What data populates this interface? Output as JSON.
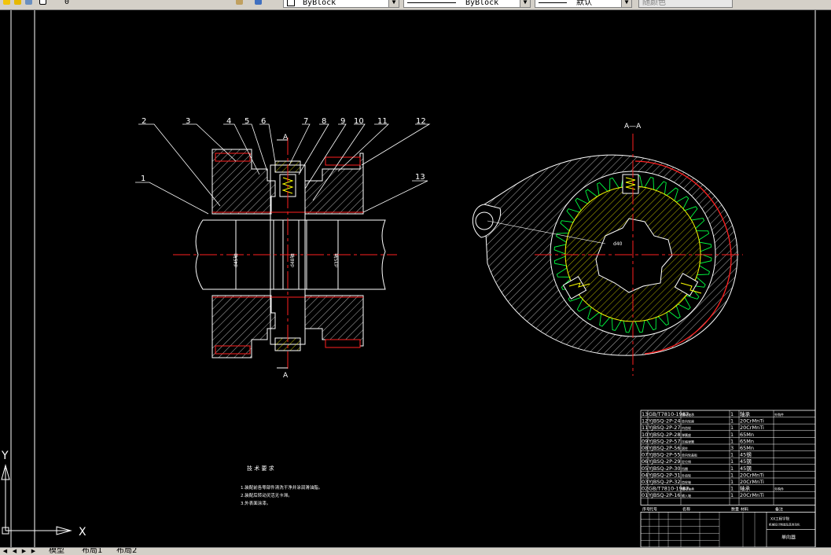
{
  "toolbar": {
    "layer_value": "0",
    "color_value": "ByBlock",
    "linetype_value": "ByBlock",
    "lineweight_value": "默认",
    "plotstyle_value": "随颜色"
  },
  "drawing": {
    "section_label": "A—A",
    "cut_label_top": "A",
    "cut_label_bottom": "A",
    "callouts": [
      "1",
      "2",
      "3",
      "4",
      "5",
      "6",
      "7",
      "8",
      "9",
      "10",
      "11",
      "12",
      "13"
    ],
    "dims": [
      "d45轴",
      "d48轴",
      "d35轴",
      "d40"
    ],
    "tech_title": "技 术 要 求",
    "tech_notes": [
      "1.装配前各零部件清洗干净并涂润滑油脂。",
      "2.装配后转动灵活无卡滞。",
      "3.外表面涂漆。"
    ],
    "ucs_y": "Y",
    "ucs_x": "X"
  },
  "bom": {
    "rows": [
      {
        "no": "13",
        "code": "GB/T7810-1987",
        "name": "滚动轴承",
        "qty": "1",
        "mat": "轴承",
        "note": "外购件"
      },
      {
        "no": "12",
        "code": "YJBSQ-2P-24",
        "name": "单向轮座",
        "qty": "1",
        "mat": "20CrMnTi",
        "note": ""
      },
      {
        "no": "11",
        "code": "YJBSQ-2P-27",
        "name": "内齿轮",
        "qty": "1",
        "mat": "20CrMnTi",
        "note": ""
      },
      {
        "no": "10",
        "code": "YJBSQ-2P-28",
        "name": "弹簧座",
        "qty": "1",
        "mat": "65Mn",
        "note": ""
      },
      {
        "no": "09",
        "code": "YJBSQ-2P-57",
        "name": "压缩弹簧",
        "qty": "1",
        "mat": "65Mn",
        "note": ""
      },
      {
        "no": "08",
        "code": "YJBSQ-2P-56",
        "name": "滚柱",
        "qty": "3",
        "mat": "65Mn",
        "note": ""
      },
      {
        "no": "07",
        "code": "YJBSQ-2P-55",
        "name": "单向轮盖板",
        "qty": "1",
        "mat": "45钢",
        "note": ""
      },
      {
        "no": "06",
        "code": "YJBSQ-2P-29",
        "name": "定位销",
        "qty": "1",
        "mat": "45钢",
        "note": ""
      },
      {
        "no": "05",
        "code": "YJBSQ-2P-30",
        "name": "挡圈",
        "qty": "1",
        "mat": "45钢",
        "note": ""
      },
      {
        "no": "04",
        "code": "YJBSQ-2P-31",
        "name": "外齿轮",
        "qty": "1",
        "mat": "20CrMnTi",
        "note": ""
      },
      {
        "no": "03",
        "code": "YJBSQ-2P-32",
        "name": "齿轮轴",
        "qty": "1",
        "mat": "20CrMnTi",
        "note": ""
      },
      {
        "no": "02",
        "code": "GB/T7810-1987",
        "name": "滚动轴承",
        "qty": "1",
        "mat": "轴承",
        "note": "外购件"
      },
      {
        "no": "01",
        "code": "YJBSQ-2P-16",
        "name": "输入轴",
        "qty": "1",
        "mat": "20CrMnTi",
        "note": ""
      }
    ],
    "header": {
      "no": "序号",
      "code": "代号",
      "name": "名称",
      "qty": "数量",
      "mat": "材料",
      "note": "备注"
    },
    "title_block": {
      "drawing_title": "单向器",
      "unit": "XX工程学院",
      "sub": "机械设计制造及其自动化"
    }
  },
  "tabs": {
    "model": "模型",
    "layout1": "布局1",
    "layout2": "布局2"
  }
}
